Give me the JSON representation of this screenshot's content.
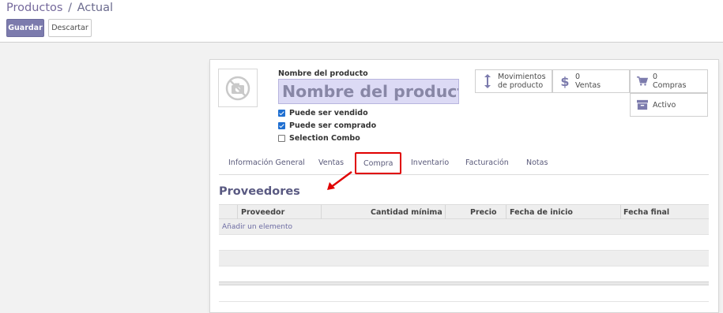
{
  "breadcrumb": {
    "parent": "Productos",
    "separator": "/",
    "current": "Actual"
  },
  "toolbar": {
    "save_label": "Guardar",
    "discard_label": "Descartar"
  },
  "product": {
    "name_label": "Nombre del producto",
    "name_placeholder": "Nombre del producto",
    "checkboxes": [
      {
        "label": "Puede ser vendido",
        "checked": true
      },
      {
        "label": "Puede ser comprado",
        "checked": true
      },
      {
        "label": "Selection Combo",
        "checked": false
      }
    ]
  },
  "stat_buttons": {
    "movements": {
      "line1": "Movimientos",
      "line2": "de producto",
      "icon": "arrows-vertical-icon"
    },
    "sales": {
      "count": "0",
      "label": "Ventas",
      "icon": "dollar-icon"
    },
    "purchases": {
      "count": "0",
      "label": "Compras",
      "icon": "cart-icon"
    },
    "active": {
      "label": "Activo",
      "icon": "archive-icon"
    }
  },
  "tabs": [
    {
      "label": "Información General"
    },
    {
      "label": "Ventas"
    },
    {
      "label": "Compra",
      "active": true
    },
    {
      "label": "Inventario"
    },
    {
      "label": "Facturación"
    },
    {
      "label": "Notas"
    }
  ],
  "suppliers": {
    "title": "Proveedores",
    "columns": [
      "Proveedor",
      "Cantidad mínima",
      "Precio",
      "Fecha de inicio",
      "Fecha final"
    ],
    "add_line": "Añadir un elemento"
  },
  "colors": {
    "primary": "#7c7bad",
    "highlight_box": "#e00000",
    "name_field_bg": "#dcdaf5"
  }
}
